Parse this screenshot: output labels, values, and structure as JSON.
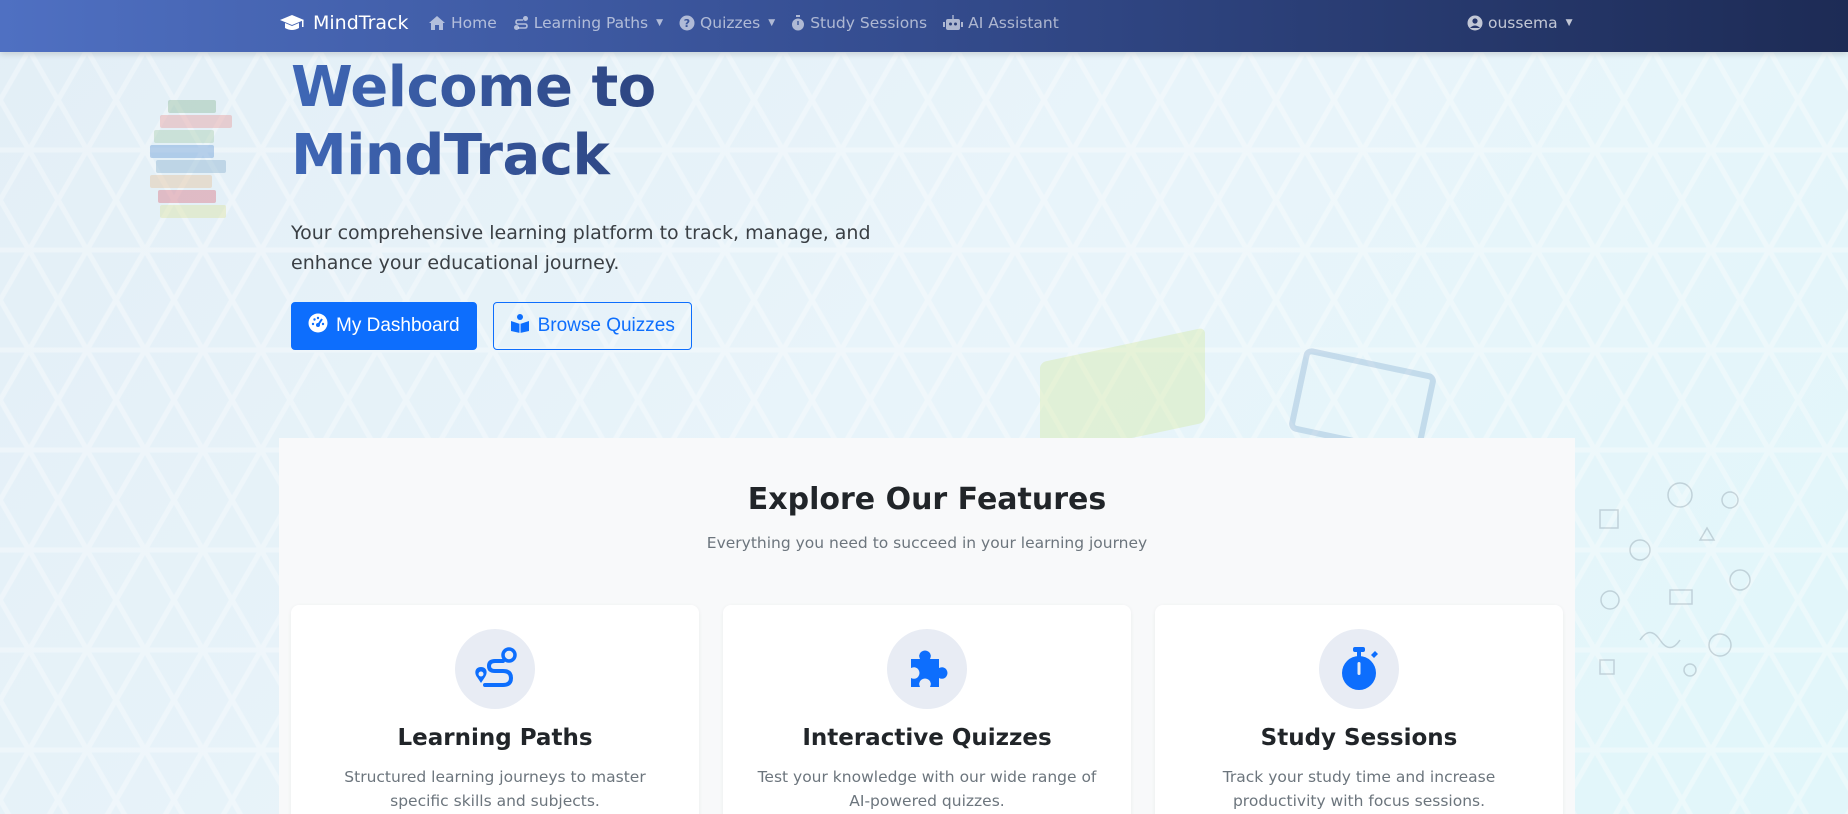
{
  "navbar": {
    "brand": "MindTrack",
    "links": [
      {
        "label": "Home",
        "icon": "home-icon"
      },
      {
        "label": "Learning Paths",
        "icon": "route-icon",
        "dropdown": true
      },
      {
        "label": "Quizzes",
        "icon": "question-circle-icon",
        "dropdown": true
      },
      {
        "label": "Study Sessions",
        "icon": "stopwatch-icon"
      },
      {
        "label": "AI Assistant",
        "icon": "robot-icon"
      }
    ],
    "user": "oussema"
  },
  "hero": {
    "title": "Welcome to MindTrack",
    "subtitle": "Your comprehensive learning platform to track, manage, and enhance your educational journey.",
    "primary_button": "My Dashboard",
    "secondary_button": "Browse Quizzes"
  },
  "features": {
    "title": "Explore Our Features",
    "subtitle": "Everything you need to succeed in your learning journey",
    "cards": [
      {
        "title": "Learning Paths",
        "text": "Structured learning journeys to master specific skills and subjects.",
        "icon": "route-icon"
      },
      {
        "title": "Interactive Quizzes",
        "text": "Test your knowledge with our wide range of AI-powered quizzes.",
        "icon": "puzzle-piece-icon"
      },
      {
        "title": "Study Sessions",
        "text": "Track your study time and increase productivity with focus sessions.",
        "icon": "stopwatch-icon"
      }
    ]
  },
  "colors": {
    "primary": "#0d6efd",
    "navbar_start": "#4f70c2",
    "navbar_end": "#1d2b55"
  }
}
